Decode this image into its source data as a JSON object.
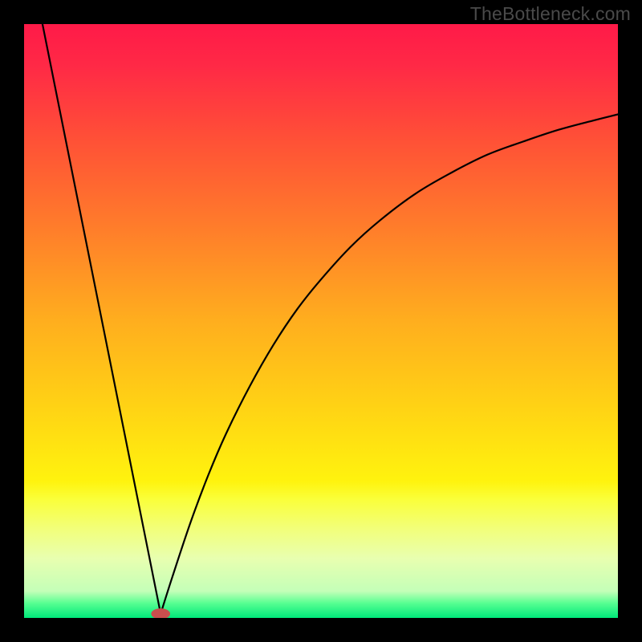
{
  "watermark": "TheBottleneck.com",
  "chart_data": {
    "type": "line",
    "title": "",
    "xlabel": "",
    "ylabel": "",
    "xlim": [
      0,
      100
    ],
    "ylim": [
      0,
      100
    ],
    "gradient": {
      "stops": [
        {
          "offset": 0.0,
          "color": "#ff1a48"
        },
        {
          "offset": 0.07,
          "color": "#ff2946"
        },
        {
          "offset": 0.2,
          "color": "#ff5236"
        },
        {
          "offset": 0.35,
          "color": "#ff7f2a"
        },
        {
          "offset": 0.5,
          "color": "#ffae1e"
        },
        {
          "offset": 0.65,
          "color": "#ffd414"
        },
        {
          "offset": 0.77,
          "color": "#fff30e"
        },
        {
          "offset": 0.8,
          "color": "#faff3a"
        },
        {
          "offset": 0.85,
          "color": "#f2ff7a"
        },
        {
          "offset": 0.9,
          "color": "#e8ffb0"
        },
        {
          "offset": 0.955,
          "color": "#c4ffb8"
        },
        {
          "offset": 0.975,
          "color": "#58ff92"
        },
        {
          "offset": 1.0,
          "color": "#00e87a"
        }
      ]
    },
    "series": [
      {
        "name": "left-slope",
        "x": [
          3.1,
          23.0
        ],
        "y": [
          100.0,
          0.7
        ]
      },
      {
        "name": "right-curve",
        "x": [
          23.0,
          25,
          28,
          31,
          34,
          38,
          42,
          46,
          50,
          55,
          60,
          66,
          72,
          78,
          84,
          90,
          96,
          100
        ],
        "y": [
          0.7,
          7,
          16,
          24,
          31,
          39,
          46,
          52,
          57,
          62.5,
          67,
          71.5,
          75,
          78,
          80.2,
          82.2,
          83.8,
          84.8
        ]
      }
    ],
    "marker": {
      "x": 23.0,
      "y": 0.7,
      "rx": 1.6,
      "ry": 0.9,
      "color": "#c94e4e"
    }
  }
}
